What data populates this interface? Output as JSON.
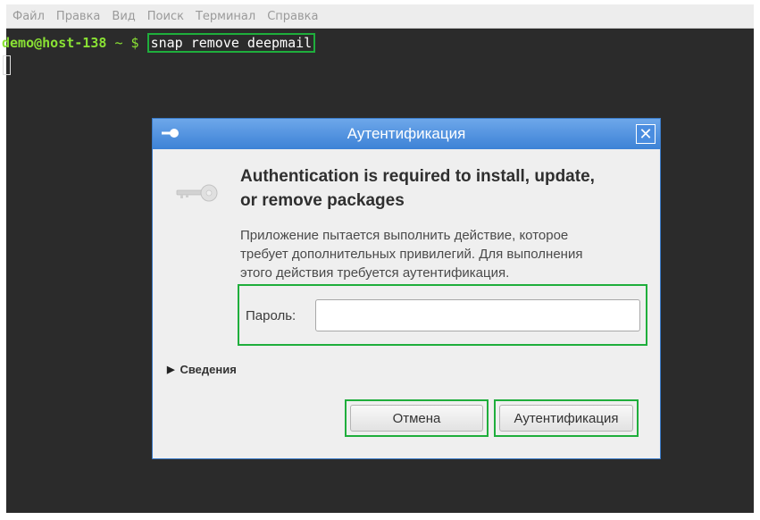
{
  "menubar": {
    "items": [
      "Файл",
      "Правка",
      "Вид",
      "Поиск",
      "Терминал",
      "Справка"
    ]
  },
  "terminal": {
    "user_host": "demo@host-138",
    "path": "~",
    "prompt_symbol": "$",
    "command": "snap remove deepmail"
  },
  "dialog": {
    "title": "Аутентификация",
    "close_symbol": "✕",
    "heading_line1": "Authentication is required to install, update,",
    "heading_line2": "or remove packages",
    "description_line1": "Приложение пытается выполнить действие, которое",
    "description_line2": "требует дополнительных привилегий. Для выполнения",
    "description_line3": "этого действия требуется аутентификация.",
    "password_label": "Пароль:",
    "password_value": "",
    "details_label": "Сведения",
    "cancel_label": "Отмена",
    "auth_label": "Аутентификация"
  },
  "icons": {
    "title_icon": "key-icon",
    "main_icon": "key-icon",
    "details_icon": "triangle-right-icon"
  },
  "colors": {
    "highlight": "#1fae3c",
    "terminal_bg": "#2b2b2b",
    "prompt": "#8ae234",
    "titlebar": "#4a8de0"
  }
}
